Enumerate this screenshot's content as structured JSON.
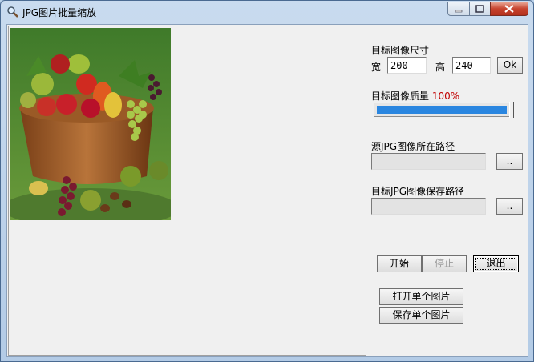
{
  "window": {
    "title": "JPG图片批量缩放"
  },
  "size": {
    "heading": "目标图像尺寸",
    "width_label": "宽",
    "width_value": "200",
    "height_label": "高",
    "height_value": "240",
    "ok_label": "Ok"
  },
  "quality": {
    "heading": "目标图像质量",
    "percent_text": "100%",
    "value": 1.0,
    "bar_color": "#2a86e0"
  },
  "source": {
    "heading": "源JPG图像所在路径",
    "path_value": "",
    "browse_label": ".."
  },
  "target": {
    "heading": "目标JPG图像保存路径",
    "path_value": "",
    "browse_label": ".."
  },
  "actions": {
    "start_label": "开始",
    "stop_label": "停止",
    "exit_label": "退出",
    "open_single_label": "打开单个图片",
    "save_single_label": "保存单个图片"
  },
  "preview": {
    "image": "fruit-basket-photo"
  }
}
